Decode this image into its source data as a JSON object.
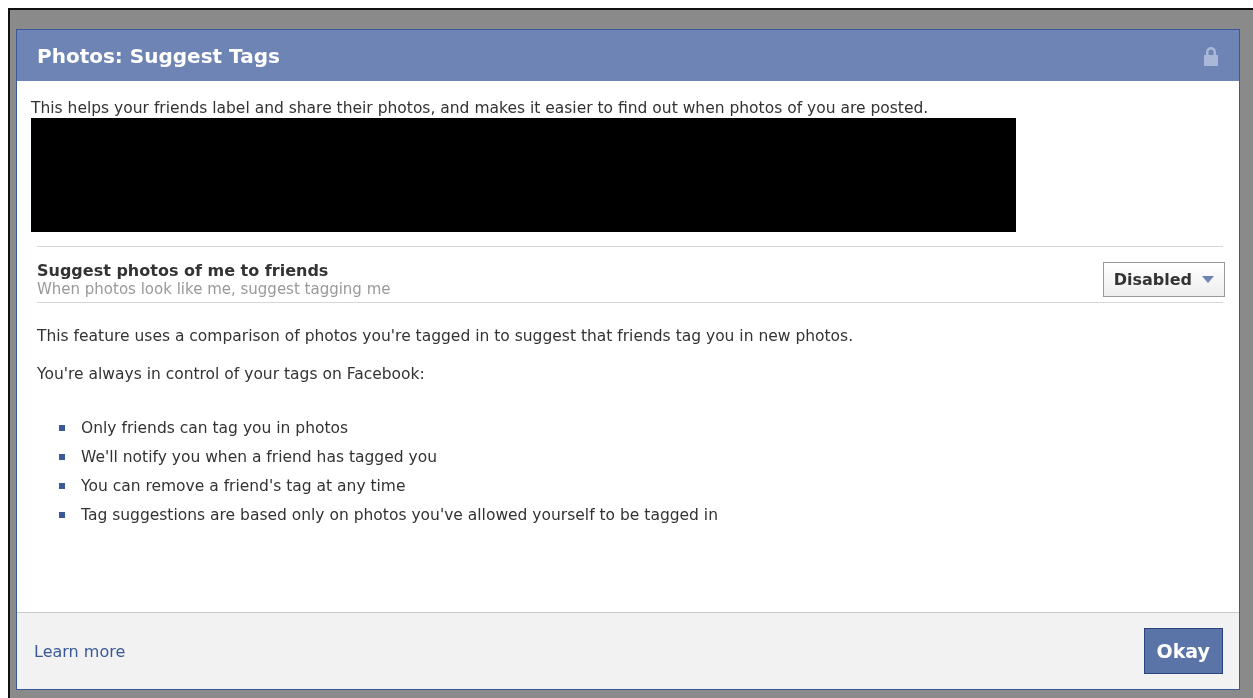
{
  "dialog": {
    "title": "Photos: Suggest Tags",
    "locked": true,
    "intro": "This helps your friends label and share their photos, and makes it easier to find out when photos of you are posted.",
    "redaction": {
      "kind": "redaction"
    },
    "setting": {
      "label": "Suggest photos of me to friends",
      "hint": "When photos look like me, suggest tagging me",
      "value": "Disabled"
    },
    "paragraphs": [
      "This feature uses a comparison of photos you're tagged in to suggest that friends tag you in new photos.",
      "You're always in control of your tags on Facebook:"
    ],
    "bullets": [
      "Only friends can tag you in photos",
      "We'll notify you when a friend has tagged you",
      "You can remove a friend's tag at any time",
      "Tag suggestions are based only on photos you've allowed yourself to be tagged in"
    ],
    "footer": {
      "link": "Learn more",
      "button": "Okay"
    }
  }
}
